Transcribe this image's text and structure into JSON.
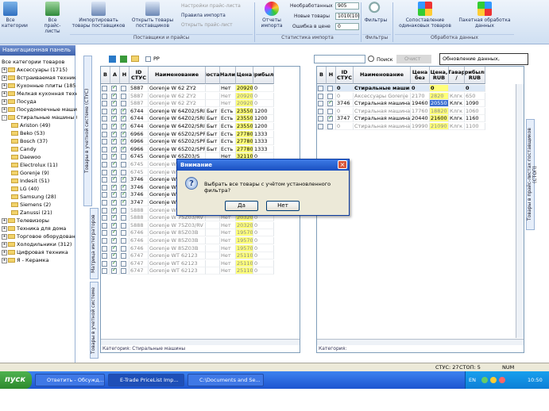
{
  "ribbon": {
    "btn_all_categories": "Все категории",
    "btn_all_pricelists": "Все прайс-листы",
    "btn_import_products": "Импортировать товары поставщиков",
    "btn_open_products": "Открыть товары поставщиков",
    "btn_price_settings": "Настройки прайс-листа",
    "btn_import_rules": "Правила импорта",
    "btn_open_pricelist": "Открыть прайс-лист",
    "group_suppliers": "Поставщики и прайсы",
    "btn_import_reports": "Отчеты импорта",
    "stat_unprocessed_label": "Необработанных",
    "stat_unprocessed_value": "905",
    "stat_new_label": "Новые товары",
    "stat_new_value": "1010(10)",
    "stat_price_errors_label": "Ошибка в цене",
    "stat_price_errors_value": "0",
    "group_import_stats": "Статистика импорта",
    "btn_filters": "Фильтры",
    "group_filters": "Фильтры",
    "btn_match_products": "Сопоставление одинаковых товаров",
    "btn_batch_processing": "Пакетная обработка данных",
    "group_data_processing": "Обработка данных",
    "tooltip": "Обновление данных, ожидайте..."
  },
  "left_panel": {
    "header": "Навигационная панель",
    "items": [
      {
        "label": "Все категории товаров",
        "indent": 0,
        "exp": ""
      },
      {
        "label": "Аксессуары (1715)",
        "indent": 0,
        "exp": "+"
      },
      {
        "label": "Встраиваемая техник",
        "indent": 0,
        "exp": "+"
      },
      {
        "label": "Кухонные плиты (185",
        "indent": 0,
        "exp": "+"
      },
      {
        "label": "Мелкая кухонная техн",
        "indent": 0,
        "exp": "+"
      },
      {
        "label": "Посуда",
        "indent": 0,
        "exp": "+"
      },
      {
        "label": "Посудомоечные машин",
        "indent": 0,
        "exp": "+"
      },
      {
        "label": "Стиральные машины (",
        "indent": 0,
        "exp": "-"
      },
      {
        "label": "Ariston (49)",
        "indent": 1,
        "exp": ""
      },
      {
        "label": "Beko (53)",
        "indent": 1,
        "exp": ""
      },
      {
        "label": "Bosch (37)",
        "indent": 1,
        "exp": ""
      },
      {
        "label": "Candy",
        "indent": 1,
        "exp": ""
      },
      {
        "label": "Daewoo",
        "indent": 1,
        "exp": ""
      },
      {
        "label": "Electrolux (11)",
        "indent": 1,
        "exp": ""
      },
      {
        "label": "Gorenje (9)",
        "indent": 1,
        "exp": ""
      },
      {
        "label": "Indesit (51)",
        "indent": 1,
        "exp": ""
      },
      {
        "label": "LG (40)",
        "indent": 1,
        "exp": ""
      },
      {
        "label": "Samsung (28)",
        "indent": 1,
        "exp": ""
      },
      {
        "label": "Siemens (2)",
        "indent": 1,
        "exp": ""
      },
      {
        "label": "Zanussi (21)",
        "indent": 1,
        "exp": ""
      },
      {
        "label": "Телевизоры",
        "indent": 0,
        "exp": "+"
      },
      {
        "label": "Техника для дома",
        "indent": 0,
        "exp": "+"
      },
      {
        "label": "Торговое оборудован",
        "indent": 0,
        "exp": "+"
      },
      {
        "label": "Холодильники (312)",
        "indent": 0,
        "exp": "+"
      },
      {
        "label": "Цифровая техника",
        "indent": 0,
        "exp": "+"
      },
      {
        "label": "Я - Керамка",
        "indent": 0,
        "exp": "+"
      }
    ]
  },
  "vtabs": {
    "left_top": "Товары в учетной системе (СТУС)",
    "left_mid": "Матрица интеграторов",
    "left_bot": "Товары в учетной системе",
    "right": "Товары в прайс-листах поставщиков (СТОП)"
  },
  "left_grid": {
    "toolbar_field": "PP",
    "headers": [
      "В",
      "А",
      "Н",
      "ID СТУС",
      "Наименование",
      "Постав",
      "Нали",
      "Цена",
      "Прибыль"
    ],
    "rows": [
      {
        "b": false,
        "a": true,
        "n": false,
        "id": "5887",
        "name": "Gorenje W 62 ZY2",
        "sup": "",
        "avail": "Нет",
        "price": "20920",
        "profit": "0",
        "yel": true,
        "grey": false
      },
      {
        "b": false,
        "a": true,
        "n": false,
        "id": "5887",
        "name": "Gorenje W 62 ZY2",
        "sup": "",
        "avail": "Нет",
        "price": "20920",
        "profit": "0",
        "yel": true,
        "grey": true
      },
      {
        "b": false,
        "a": true,
        "n": false,
        "id": "5887",
        "name": "Gorenje W 62 ZY2",
        "sup": "",
        "avail": "Нет",
        "price": "20920",
        "profit": "0",
        "yel": true,
        "grey": true
      },
      {
        "b": false,
        "a": true,
        "n": true,
        "id": "6744",
        "name": "Gorenje W 64Z02/SRIV",
        "sup": "Быт",
        "avail": "Есть",
        "price": "23550",
        "profit": "1200",
        "yel": true,
        "grey": false
      },
      {
        "b": false,
        "a": true,
        "n": true,
        "id": "6744",
        "name": "Gorenje W 64Z02/SRIV",
        "sup": "Быт",
        "avail": "Есть",
        "price": "23550",
        "profit": "1200",
        "yel": true,
        "grey": false
      },
      {
        "b": false,
        "a": true,
        "n": true,
        "id": "6744",
        "name": "Gorenje W 64Z02/SRIV",
        "sup": "Быт",
        "avail": "Есть",
        "price": "23550",
        "profit": "1200",
        "yel": true,
        "grey": false
      },
      {
        "b": false,
        "a": true,
        "n": true,
        "id": "6966",
        "name": "Gorenje W 65Z02/SPRIV",
        "sup": "Быт",
        "avail": "Есть",
        "price": "27780",
        "profit": "1333",
        "yel": true,
        "grey": false
      },
      {
        "b": false,
        "a": true,
        "n": true,
        "id": "6966",
        "name": "Gorenje W 65Z02/SPRIV",
        "sup": "Быт",
        "avail": "Есть",
        "price": "27780",
        "profit": "1333",
        "yel": true,
        "grey": false
      },
      {
        "b": false,
        "a": true,
        "n": true,
        "id": "6966",
        "name": "Gorenje W 65Z02/SPRIV",
        "sup": "Быт",
        "avail": "Есть",
        "price": "27780",
        "profit": "1333",
        "yel": true,
        "grey": false
      },
      {
        "b": false,
        "a": true,
        "n": false,
        "id": "6745",
        "name": "Gorenje W 65Z03/S",
        "sup": "",
        "avail": "Нет",
        "price": "32110",
        "profit": "0",
        "yel": true,
        "grey": false
      },
      {
        "b": false,
        "a": true,
        "n": false,
        "id": "6745",
        "name": "Gorenje W",
        "sup": "",
        "avail": "",
        "price": "",
        "profit": "",
        "yel": false,
        "grey": true
      },
      {
        "b": false,
        "a": true,
        "n": false,
        "id": "6745",
        "name": "Gorenje W",
        "sup": "",
        "avail": "",
        "price": "",
        "profit": "",
        "yel": false,
        "grey": true
      },
      {
        "b": false,
        "a": true,
        "n": true,
        "id": "3746",
        "name": "Gorenje W",
        "sup": "",
        "avail": "",
        "price": "",
        "profit": "",
        "yel": false,
        "grey": false
      },
      {
        "b": false,
        "a": true,
        "n": true,
        "id": "3746",
        "name": "Gorenje W",
        "sup": "",
        "avail": "",
        "price": "",
        "profit": "",
        "yel": false,
        "grey": false
      },
      {
        "b": false,
        "a": true,
        "n": true,
        "id": "3746",
        "name": "Gorenje W",
        "sup": "",
        "avail": "",
        "price": "",
        "profit": "",
        "yel": false,
        "grey": false
      },
      {
        "b": false,
        "a": true,
        "n": true,
        "id": "3747",
        "name": "Gorenje W",
        "sup": "",
        "avail": "",
        "price": "",
        "profit": "",
        "yel": false,
        "grey": false
      },
      {
        "b": false,
        "a": true,
        "n": false,
        "id": "5888",
        "name": "Gorenje W 75Z03/RV",
        "sup": "",
        "avail": "Нет",
        "price": "20320",
        "profit": "0",
        "yel": true,
        "grey": true
      },
      {
        "b": false,
        "a": true,
        "n": false,
        "id": "5888",
        "name": "Gorenje W 75Z03/RV",
        "sup": "",
        "avail": "Нет",
        "price": "20320",
        "profit": "0",
        "yel": true,
        "grey": true
      },
      {
        "b": false,
        "a": true,
        "n": false,
        "id": "5888",
        "name": "Gorenje W 75Z03/RV",
        "sup": "",
        "avail": "Нет",
        "price": "20320",
        "profit": "0",
        "yel": true,
        "grey": true
      },
      {
        "b": false,
        "a": true,
        "n": false,
        "id": "6746",
        "name": "Gorenje W 85Z03B",
        "sup": "",
        "avail": "Нет",
        "price": "19570",
        "profit": "0",
        "yel": true,
        "grey": true
      },
      {
        "b": false,
        "a": true,
        "n": false,
        "id": "6746",
        "name": "Gorenje W 85Z03B",
        "sup": "",
        "avail": "Нет",
        "price": "19570",
        "profit": "0",
        "yel": true,
        "grey": true
      },
      {
        "b": false,
        "a": true,
        "n": false,
        "id": "6746",
        "name": "Gorenje W 85Z03B",
        "sup": "",
        "avail": "Нет",
        "price": "19570",
        "profit": "0",
        "yel": true,
        "grey": true
      },
      {
        "b": false,
        "a": true,
        "n": false,
        "id": "6747",
        "name": "Gorenje WT 62123",
        "sup": "",
        "avail": "Нет",
        "price": "25110",
        "profit": "0",
        "yel": true,
        "grey": true
      },
      {
        "b": false,
        "a": true,
        "n": false,
        "id": "6747",
        "name": "Gorenje WT 62123",
        "sup": "",
        "avail": "Нет",
        "price": "25110",
        "profit": "0",
        "yel": true,
        "grey": true
      },
      {
        "b": false,
        "a": true,
        "n": false,
        "id": "6747",
        "name": "Gorenje WT 62123",
        "sup": "",
        "avail": "Нет",
        "price": "25110",
        "profit": "0",
        "yel": true,
        "grey": true
      }
    ],
    "category_footer": "Категория: Стиральные машины"
  },
  "right_grid": {
    "search_label": "Поиск",
    "clear_label": "Очист",
    "headers": [
      "В",
      "Н",
      "ID СТУС",
      "Наименование",
      "Цена без",
      "Цена, RUB",
      "Тавар /",
      "Прибыль, RUB"
    ],
    "rows": [
      {
        "b": false,
        "n": false,
        "id": "0",
        "name": "Стиральные машины",
        "p1": "0",
        "p2": "0",
        "unit": "",
        "profit": "0",
        "bold": true,
        "grey": false,
        "hl": false
      },
      {
        "b": false,
        "n": false,
        "id": "0",
        "name": "Аксессуары Gorenje веза",
        "p1": "2170",
        "p2": "2820",
        "unit": "Клгк",
        "profit": "650",
        "bold": false,
        "grey": true,
        "hl": false
      },
      {
        "b": false,
        "n": true,
        "id": "3746",
        "name": "Стиральная машина GOR",
        "p1": "19460",
        "p2": "20550",
        "unit": "Клгк",
        "profit": "1090",
        "bold": false,
        "grey": false,
        "hl": true
      },
      {
        "b": false,
        "n": false,
        "id": "0",
        "name": "Стиральная машина GOR",
        "p1": "17760",
        "p2": "18820",
        "unit": "Клгк",
        "profit": "1060",
        "bold": false,
        "grey": true,
        "hl": false
      },
      {
        "b": false,
        "n": true,
        "id": "3747",
        "name": "Стиральная машина GOR",
        "p1": "20440",
        "p2": "21600",
        "unit": "Клгк",
        "profit": "1160",
        "bold": false,
        "grey": false,
        "hl": false
      },
      {
        "b": false,
        "n": false,
        "id": "0",
        "name": "Стиральная машина GOR",
        "p1": "19990",
        "p2": "21090",
        "unit": "Клгк",
        "profit": "1100",
        "bold": false,
        "grey": true,
        "hl": false
      }
    ],
    "category_footer": "Категория:"
  },
  "dialog": {
    "title": "Внимание",
    "message": "Выбрать все товары с учётом установленного фильтра?",
    "yes": "Да",
    "no": "Нет"
  },
  "statusbar": {
    "stus": "СТУС: 27",
    "stop": "СТОП: 5",
    "num": "NUM"
  },
  "taskbar": {
    "start": "пуск",
    "tasks": [
      "Ответить - Обсужд...",
      "E-Trade PriceList Imp...",
      "C:\\Documents and Se..."
    ],
    "lang": "EN",
    "time": "10:50"
  }
}
